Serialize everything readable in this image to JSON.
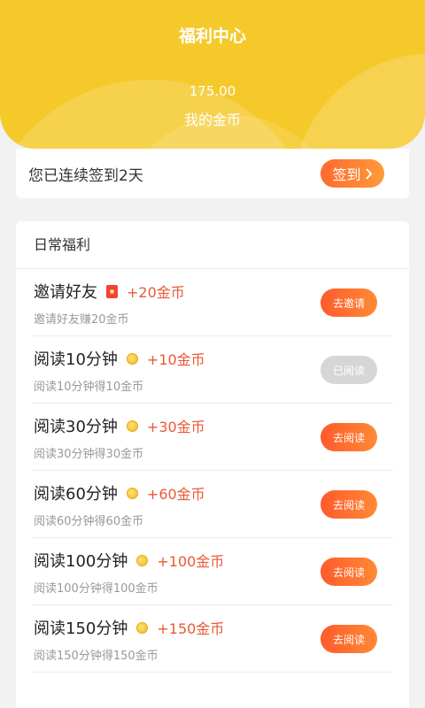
{
  "header": {
    "title": "福利中心",
    "coins_value": "175.00",
    "coins_label": "我的金币"
  },
  "checkin": {
    "status_text": "您已连续签到2天",
    "button_label": "签到",
    "button_icon": "chevron-right-icon"
  },
  "daily": {
    "title": "日常福利",
    "tasks": [
      {
        "name": "邀请好友",
        "icon": "red-envelope-icon",
        "reward": "+20金币",
        "desc": "邀请好友赚20金币",
        "action": "去邀请",
        "done": false
      },
      {
        "name": "阅读10分钟",
        "icon": "coin-icon",
        "reward": "+10金币",
        "desc": "阅读10分钟得10金币",
        "action": "已阅读",
        "done": true
      },
      {
        "name": "阅读30分钟",
        "icon": "coin-icon",
        "reward": "+30金币",
        "desc": "阅读30分钟得30金币",
        "action": "去阅读",
        "done": false
      },
      {
        "name": "阅读60分钟",
        "icon": "coin-icon",
        "reward": "+60金币",
        "desc": "阅读60分钟得60金币",
        "action": "去阅读",
        "done": false
      },
      {
        "name": "阅读100分钟",
        "icon": "coin-icon",
        "reward": "+100金币",
        "desc": "阅读100分钟得100金币",
        "action": "去阅读",
        "done": false
      },
      {
        "name": "阅读150分钟",
        "icon": "coin-icon",
        "reward": "+150金币",
        "desc": "阅读150分钟得150金币",
        "action": "去阅读",
        "done": false
      }
    ]
  },
  "colors": {
    "header_bg": "#f5c92a",
    "accent_orange": "#ff6a2e",
    "reward_red": "#e85a35",
    "done_gray": "#d6d6d6"
  }
}
